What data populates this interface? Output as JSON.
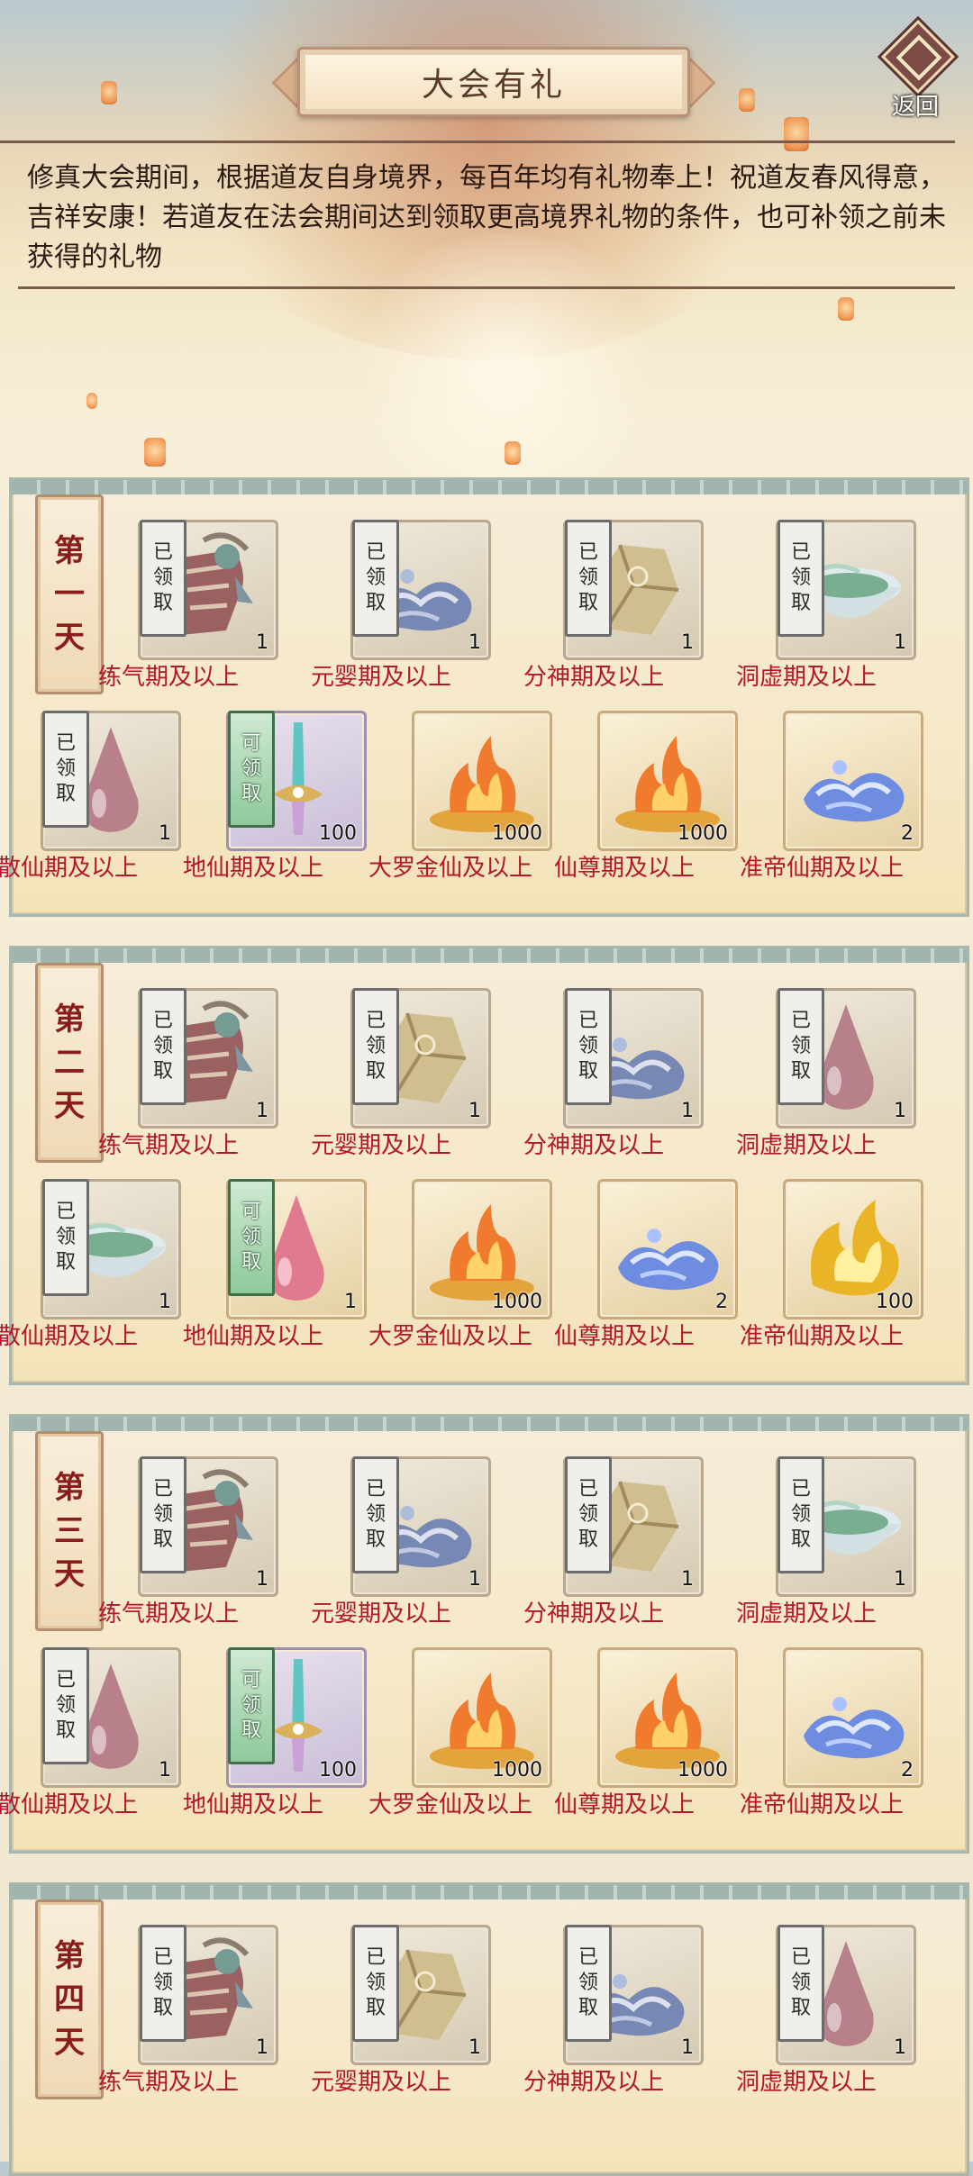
{
  "header": {
    "title": "大会有礼",
    "back_label": "返回"
  },
  "description": "修真大会期间，根据道友自身境界，每百年均有礼物奉上！祝道友春风得意，吉祥安康！若道友在法会期间达到领取更高境界礼物的条件，也可补领之前未获得的礼物",
  "status_labels": {
    "claimed": [
      "已",
      "领",
      "取"
    ],
    "claimable": [
      "可",
      "领",
      "取"
    ]
  },
  "colors": {
    "label_red": "#b2182b",
    "claimable_green": "#8fc99b",
    "banner_red": "#8b1c1c"
  },
  "days": [
    {
      "name": [
        "第",
        "一",
        "天"
      ],
      "rewards": [
        {
          "label": "练气期及以上",
          "qty": "1",
          "icon": "scroll-bag-icon",
          "status": "claimed"
        },
        {
          "label": "元婴期及以上",
          "qty": "1",
          "icon": "blue-water-icon",
          "status": "claimed"
        },
        {
          "label": "分神期及以上",
          "qty": "1",
          "icon": "gold-ore-icon",
          "status": "claimed"
        },
        {
          "label": "洞虚期及以上",
          "qty": "1",
          "icon": "jade-bowl-icon",
          "status": "claimed"
        },
        {
          "label": "散仙期及以上",
          "qty": "1",
          "icon": "pink-drop-icon",
          "status": "claimed"
        },
        {
          "label": "地仙期及以上",
          "qty": "100",
          "icon": "jade-sword-icon",
          "status": "claimable"
        },
        {
          "label": "大罗金仙及以上",
          "qty": "1000",
          "icon": "fire-altar-icon",
          "status": "none"
        },
        {
          "label": "仙尊期及以上",
          "qty": "1000",
          "icon": "fire-altar-icon",
          "status": "none"
        },
        {
          "label": "准帝仙期及以上",
          "qty": "2",
          "icon": "blue-water-icon",
          "status": "none"
        }
      ]
    },
    {
      "name": [
        "第",
        "二",
        "天"
      ],
      "rewards": [
        {
          "label": "练气期及以上",
          "qty": "1",
          "icon": "scroll-bag-icon",
          "status": "claimed"
        },
        {
          "label": "元婴期及以上",
          "qty": "1",
          "icon": "gold-ore-icon",
          "status": "claimed"
        },
        {
          "label": "分神期及以上",
          "qty": "1",
          "icon": "blue-water-icon",
          "status": "claimed"
        },
        {
          "label": "洞虚期及以上",
          "qty": "1",
          "icon": "pink-drop-icon",
          "status": "claimed"
        },
        {
          "label": "散仙期及以上",
          "qty": "1",
          "icon": "jade-bowl-icon",
          "status": "claimed"
        },
        {
          "label": "地仙期及以上",
          "qty": "1",
          "icon": "pink-drop-icon",
          "status": "claimable"
        },
        {
          "label": "大罗金仙及以上",
          "qty": "1000",
          "icon": "fire-altar-icon",
          "status": "none"
        },
        {
          "label": "仙尊期及以上",
          "qty": "2",
          "icon": "blue-water-icon",
          "status": "none"
        },
        {
          "label": "准帝仙期及以上",
          "qty": "100",
          "icon": "golden-flame-icon",
          "status": "none"
        }
      ]
    },
    {
      "name": [
        "第",
        "三",
        "天"
      ],
      "rewards": [
        {
          "label": "练气期及以上",
          "qty": "1",
          "icon": "scroll-bag-icon",
          "status": "claimed"
        },
        {
          "label": "元婴期及以上",
          "qty": "1",
          "icon": "blue-water-icon",
          "status": "claimed"
        },
        {
          "label": "分神期及以上",
          "qty": "1",
          "icon": "gold-ore-icon",
          "status": "claimed"
        },
        {
          "label": "洞虚期及以上",
          "qty": "1",
          "icon": "jade-bowl-icon",
          "status": "claimed"
        },
        {
          "label": "散仙期及以上",
          "qty": "1",
          "icon": "pink-drop-icon",
          "status": "claimed"
        },
        {
          "label": "地仙期及以上",
          "qty": "100",
          "icon": "jade-sword-icon",
          "status": "claimable"
        },
        {
          "label": "大罗金仙及以上",
          "qty": "1000",
          "icon": "fire-altar-icon",
          "status": "none"
        },
        {
          "label": "仙尊期及以上",
          "qty": "1000",
          "icon": "fire-altar-icon",
          "status": "none"
        },
        {
          "label": "准帝仙期及以上",
          "qty": "2",
          "icon": "blue-water-icon",
          "status": "none"
        }
      ]
    },
    {
      "name": [
        "第",
        "四",
        "天"
      ],
      "rewards": [
        {
          "label": "练气期及以上",
          "qty": "1",
          "icon": "scroll-bag-icon",
          "status": "claimed"
        },
        {
          "label": "元婴期及以上",
          "qty": "1",
          "icon": "gold-ore-icon",
          "status": "claimed"
        },
        {
          "label": "分神期及以上",
          "qty": "1",
          "icon": "blue-water-icon",
          "status": "claimed"
        },
        {
          "label": "洞虚期及以上",
          "qty": "1",
          "icon": "pink-drop-icon",
          "status": "claimed"
        }
      ]
    }
  ]
}
